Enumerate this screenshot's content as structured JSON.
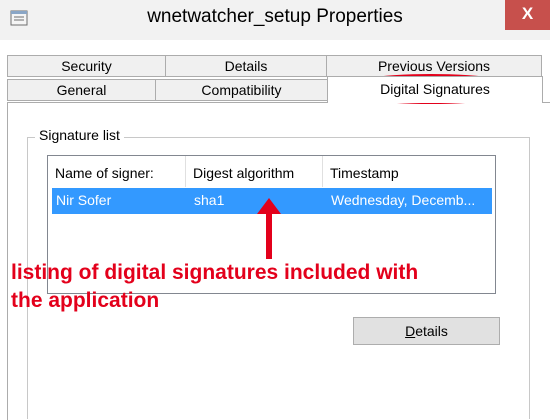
{
  "window": {
    "title": "wnetwatcher_setup Properties",
    "close_glyph": "X"
  },
  "tabs": {
    "row_top": [
      "Security",
      "Details",
      "Previous Versions"
    ],
    "row_bottom": [
      "General",
      "Compatibility",
      "Digital Signatures"
    ],
    "active": "Digital Signatures"
  },
  "signature_list": {
    "label": "Signature list",
    "columns": [
      "Name of signer:",
      "Digest algorithm",
      "Timestamp"
    ],
    "rows": [
      {
        "name": "Nir Sofer",
        "digest": "sha1",
        "timestamp": "Wednesday, Decemb..."
      }
    ],
    "selected_row": 0
  },
  "details_button": {
    "label": "Details",
    "accelerator": "D"
  },
  "annotation": {
    "line1": "listing of digital signatures included with",
    "line2": "the application",
    "color": "#e3001b"
  },
  "colors": {
    "selection": "#3399ff",
    "close_button": "#c7504c"
  }
}
